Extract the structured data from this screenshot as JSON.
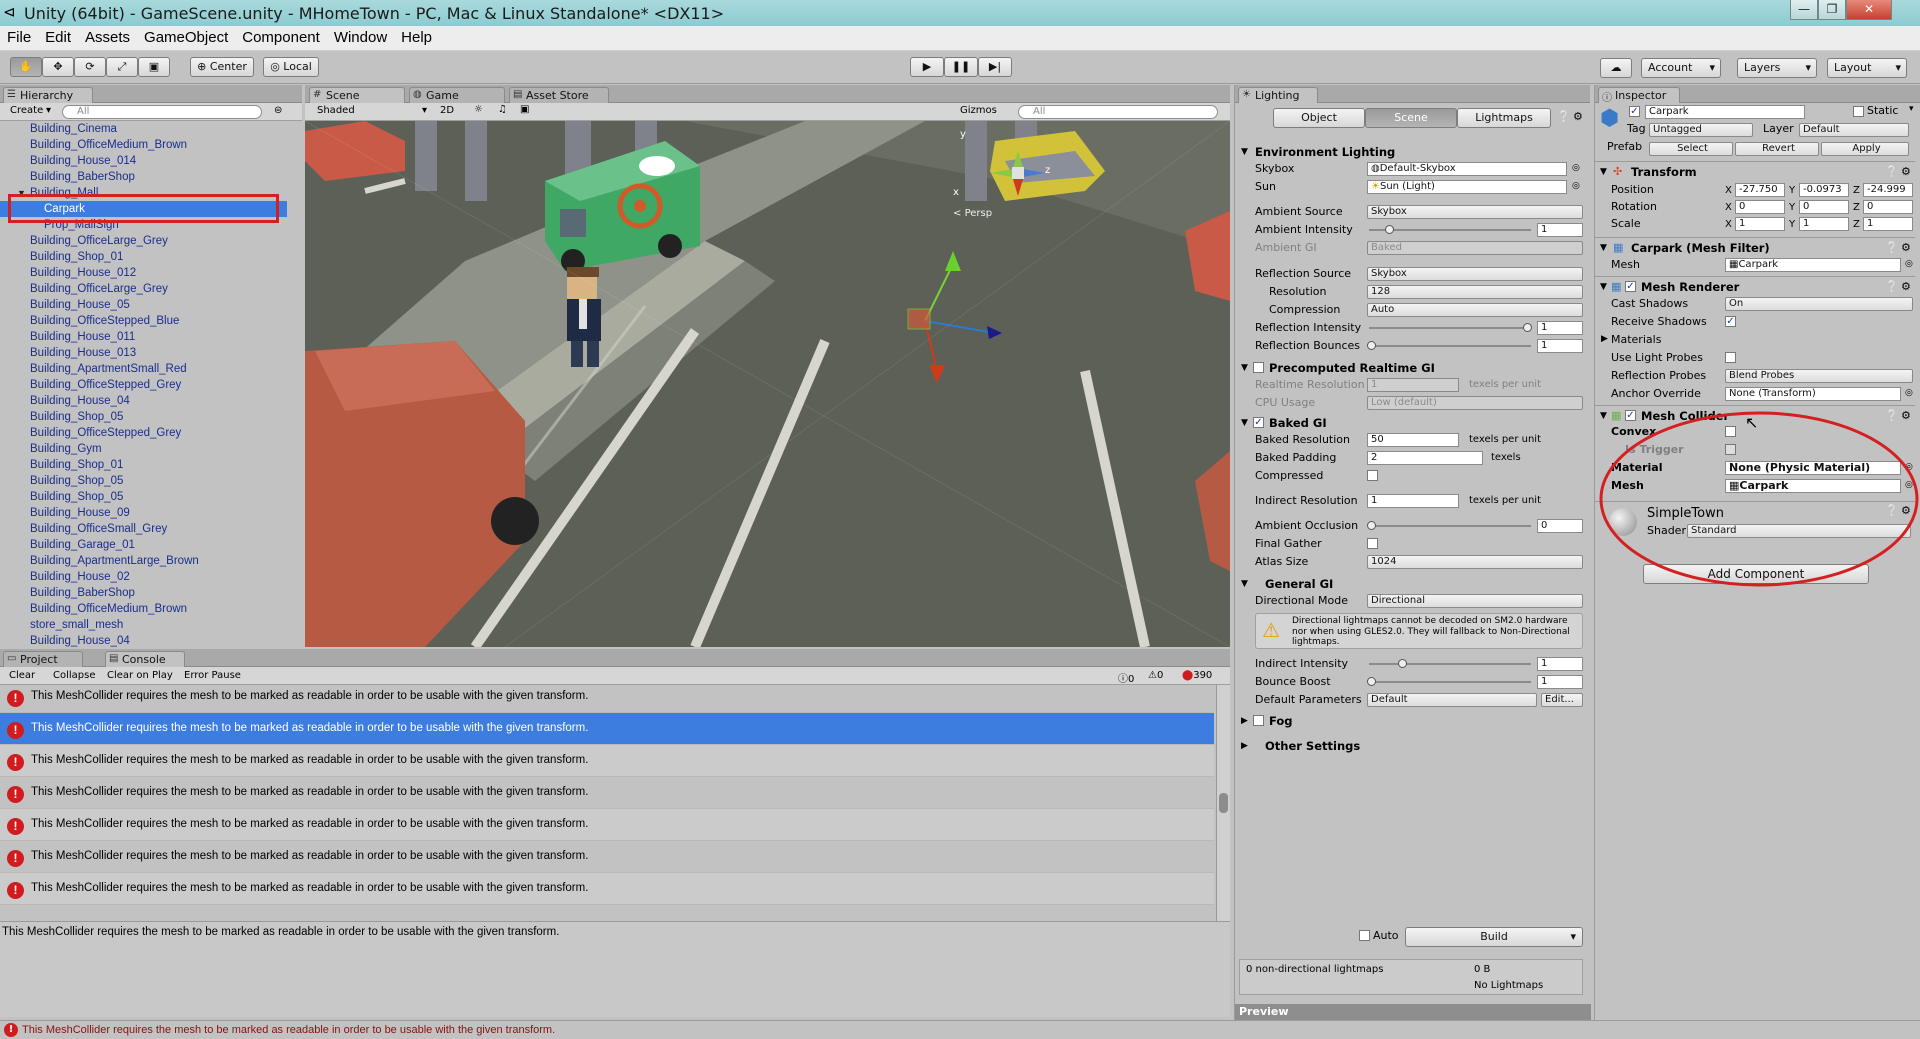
{
  "window": {
    "title": "Unity (64bit) - GameScene.unity - MHomeTown - PC, Mac & Linux Standalone* <DX11>",
    "minimize": "—",
    "maximize": "❐",
    "close": "✕"
  },
  "menu": [
    "File",
    "Edit",
    "Assets",
    "GameObject",
    "Component",
    "Window",
    "Help"
  ],
  "toolbar": {
    "center": "Center",
    "local": "Local",
    "account": "Account",
    "layers": "Layers",
    "layout": "Layout"
  },
  "hierarchy": {
    "tab": "Hierarchy",
    "create": "Create",
    "search_placeholder": "All",
    "items": [
      "Building_Cinema",
      "Building_OfficeMedium_Brown",
      "Building_House_014",
      "Building_BaberShop",
      "Building_Mall",
      "Carpark",
      "Prop_MallSign",
      "Building_OfficeLarge_Grey",
      "Building_Shop_01",
      "Building_House_012",
      "Building_OfficeLarge_Grey",
      "Building_House_05",
      "Building_OfficeStepped_Blue",
      "Building_House_011",
      "Building_House_013",
      "Building_ApartmentSmall_Red",
      "Building_OfficeStepped_Grey",
      "Building_House_04",
      "Building_Shop_05",
      "Building_OfficeStepped_Grey",
      "Building_Gym",
      "Building_Shop_01",
      "Building_Shop_05",
      "Building_Shop_05",
      "Building_House_09",
      "Building_OfficeSmall_Grey",
      "Building_Garage_01",
      "Building_ApartmentLarge_Brown",
      "Building_House_02",
      "Building_BaberShop",
      "Building_OfficeMedium_Brown",
      "store_small_mesh",
      "Building_House_04"
    ]
  },
  "scene": {
    "tabs": [
      "Scene",
      "Game",
      "Asset Store"
    ],
    "shading": "Shaded",
    "mode_2d": "2D",
    "gizmos": "Gizmos",
    "search_placeholder": "All",
    "persp": "Persp",
    "axis_y": "y",
    "axis_x": "x",
    "axis_z": "z"
  },
  "console": {
    "tabs": [
      "Project",
      "Console"
    ],
    "buttons": [
      "Clear",
      "Collapse",
      "Clear on Play",
      "Error Pause"
    ],
    "info_count": "0",
    "warn_count": "0",
    "error_count": "390",
    "message": "This MeshCollider requires the mesh to be marked as readable in order to be usable with the given transform.",
    "detail": "This MeshCollider requires the mesh to be marked as readable in order to be usable with the given transform.",
    "status": "This MeshCollider requires the mesh to be marked as readable in order to be usable with the given transform."
  },
  "lighting": {
    "tab": "Lighting",
    "modes": [
      "Object",
      "Scene",
      "Lightmaps"
    ],
    "environment": {
      "header": "Environment Lighting",
      "skybox_label": "Skybox",
      "skybox": "Default-Skybox",
      "sun_label": "Sun",
      "sun": "Sun (Light)",
      "ambient_source_label": "Ambient Source",
      "ambient_source": "Skybox",
      "ambient_intensity_label": "Ambient Intensity",
      "ambient_intensity": "1",
      "ambient_gi_label": "Ambient GI",
      "ambient_gi": "Baked",
      "reflection_source_label": "Reflection Source",
      "reflection_source": "Skybox",
      "resolution_label": "Resolution",
      "resolution": "128",
      "compression_label": "Compression",
      "compression": "Auto",
      "reflection_intensity_label": "Reflection Intensity",
      "reflection_intensity": "1",
      "reflection_bounces_label": "Reflection Bounces",
      "reflection_bounces": "1"
    },
    "precomputed": {
      "header": "Precomputed Realtime GI",
      "realtime_resolution_label": "Realtime Resolution",
      "realtime_resolution": "1",
      "unit": "texels per unit",
      "cpu_usage_label": "CPU Usage",
      "cpu_usage": "Low (default)"
    },
    "baked": {
      "header": "Baked GI",
      "baked_resolution_label": "Baked Resolution",
      "baked_resolution": "50",
      "unit_res": "texels per unit",
      "baked_padding_label": "Baked Padding",
      "baked_padding": "2",
      "unit_pad": "texels",
      "compressed_label": "Compressed",
      "indirect_resolution_label": "Indirect Resolution",
      "indirect_resolution": "1",
      "unit_ind": "texels per unit",
      "ambient_occlusion_label": "Ambient Occlusion",
      "ambient_occlusion": "0",
      "final_gather_label": "Final Gather",
      "atlas_size_label": "Atlas Size",
      "atlas_size": "1024"
    },
    "general": {
      "header": "General GI",
      "directional_mode_label": "Directional Mode",
      "directional_mode": "Directional",
      "warning": "Directional lightmaps cannot be decoded on SM2.0 hardware nor when using GLES2.0. They will fallback to Non-Directional lightmaps.",
      "indirect_intensity_label": "Indirect Intensity",
      "indirect_intensity": "1",
      "bounce_boost_label": "Bounce Boost",
      "bounce_boost": "1",
      "default_parameters_label": "Default Parameters",
      "default_parameters": "Default",
      "edit": "Edit..."
    },
    "fog": "Fog",
    "other": "Other Settings",
    "auto": "Auto",
    "build": "Build",
    "lightmaps_count": "0 non-directional lightmaps",
    "lightmaps_size": "0 B",
    "no_lightmaps": "No Lightmaps",
    "preview": "Preview"
  },
  "inspector": {
    "tab": "Inspector",
    "object_name": "Carpark",
    "static": "Static",
    "tag_label": "Tag",
    "tag": "Untagged",
    "layer_label": "Layer",
    "layer": "Default",
    "prefab_label": "Prefab",
    "select": "Select",
    "revert": "Revert",
    "apply": "Apply",
    "transform": {
      "header": "Transform",
      "position_label": "Position",
      "px": "-27.750",
      "py": "-0.0973",
      "pz": "-24.999",
      "rotation_label": "Rotation",
      "rx": "0",
      "ry": "0",
      "rz": "0",
      "scale_label": "Scale",
      "sx": "1",
      "sy": "1",
      "sz": "1"
    },
    "mesh_filter": {
      "header": "Carpark (Mesh Filter)",
      "mesh_label": "Mesh",
      "mesh": "Carpark"
    },
    "mesh_renderer": {
      "header": "Mesh Renderer",
      "cast_shadows_label": "Cast Shadows",
      "cast_shadows": "On",
      "receive_shadows_label": "Receive Shadows",
      "materials_label": "Materials",
      "light_probes_label": "Use Light Probes",
      "reflection_probes_label": "Reflection Probes",
      "reflection_probes": "Blend Probes",
      "anchor_label": "Anchor Override",
      "anchor": "None (Transform)"
    },
    "mesh_collider": {
      "header": "Mesh Collider",
      "convex_label": "Convex",
      "trigger_label": "Is Trigger",
      "material_label": "Material",
      "material": "None (Physic Material)",
      "mesh_label": "Mesh",
      "mesh": "Carpark"
    },
    "material": {
      "name": "SimpleTown",
      "shader_label": "Shader",
      "shader": "Standard"
    },
    "add_component": "Add Component"
  },
  "colors": {
    "selection": "#3e7de0",
    "annotation": "#d42020",
    "error": "#d01c1c"
  }
}
